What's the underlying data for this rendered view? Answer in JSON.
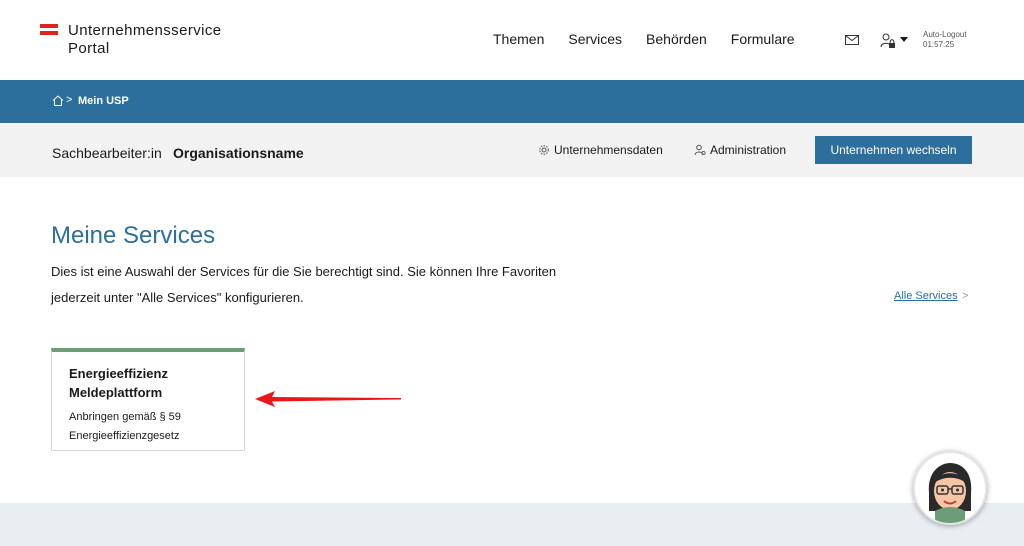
{
  "header": {
    "logo_line1": "Unternehmensservice",
    "logo_line2": "Portal",
    "nav": [
      "Themen",
      "Services",
      "Behörden",
      "Formulare"
    ],
    "auto_logout_label": "Auto-Logout",
    "auto_logout_time": "01:57:25",
    "icons": [
      "mail-icon",
      "user-lock-icon",
      "caret-down-icon"
    ]
  },
  "breadcrumb": {
    "home_icon": "home-icon",
    "separator": ">",
    "current": "Mein USP"
  },
  "org": {
    "role": "Sachbearbeiter:in",
    "name": "Organisationsname",
    "company_data_link": "Unternehmensdaten",
    "administration_link": "Administration",
    "switch_button": "Unternehmen wechseln"
  },
  "main": {
    "title": "Meine Services",
    "intro": "Dies ist eine Auswahl der Services für die Sie berechtigt sind. Sie können Ihre Favoriten jederzeit unter \"Alle Services\" konfigurieren.",
    "all_services_link": "Alle Services",
    "all_services_chevron": ">"
  },
  "cards": [
    {
      "title": "Energieeffizienz Meldeplattform",
      "description": "Anbringen gemäß § 59 Energieeffizienzgesetz"
    }
  ],
  "colors": {
    "brand_blue": "#2c6f9c",
    "card_accent": "#6b9e76",
    "annotation_arrow": "#e8171c",
    "austria_red": "#e2231a"
  }
}
